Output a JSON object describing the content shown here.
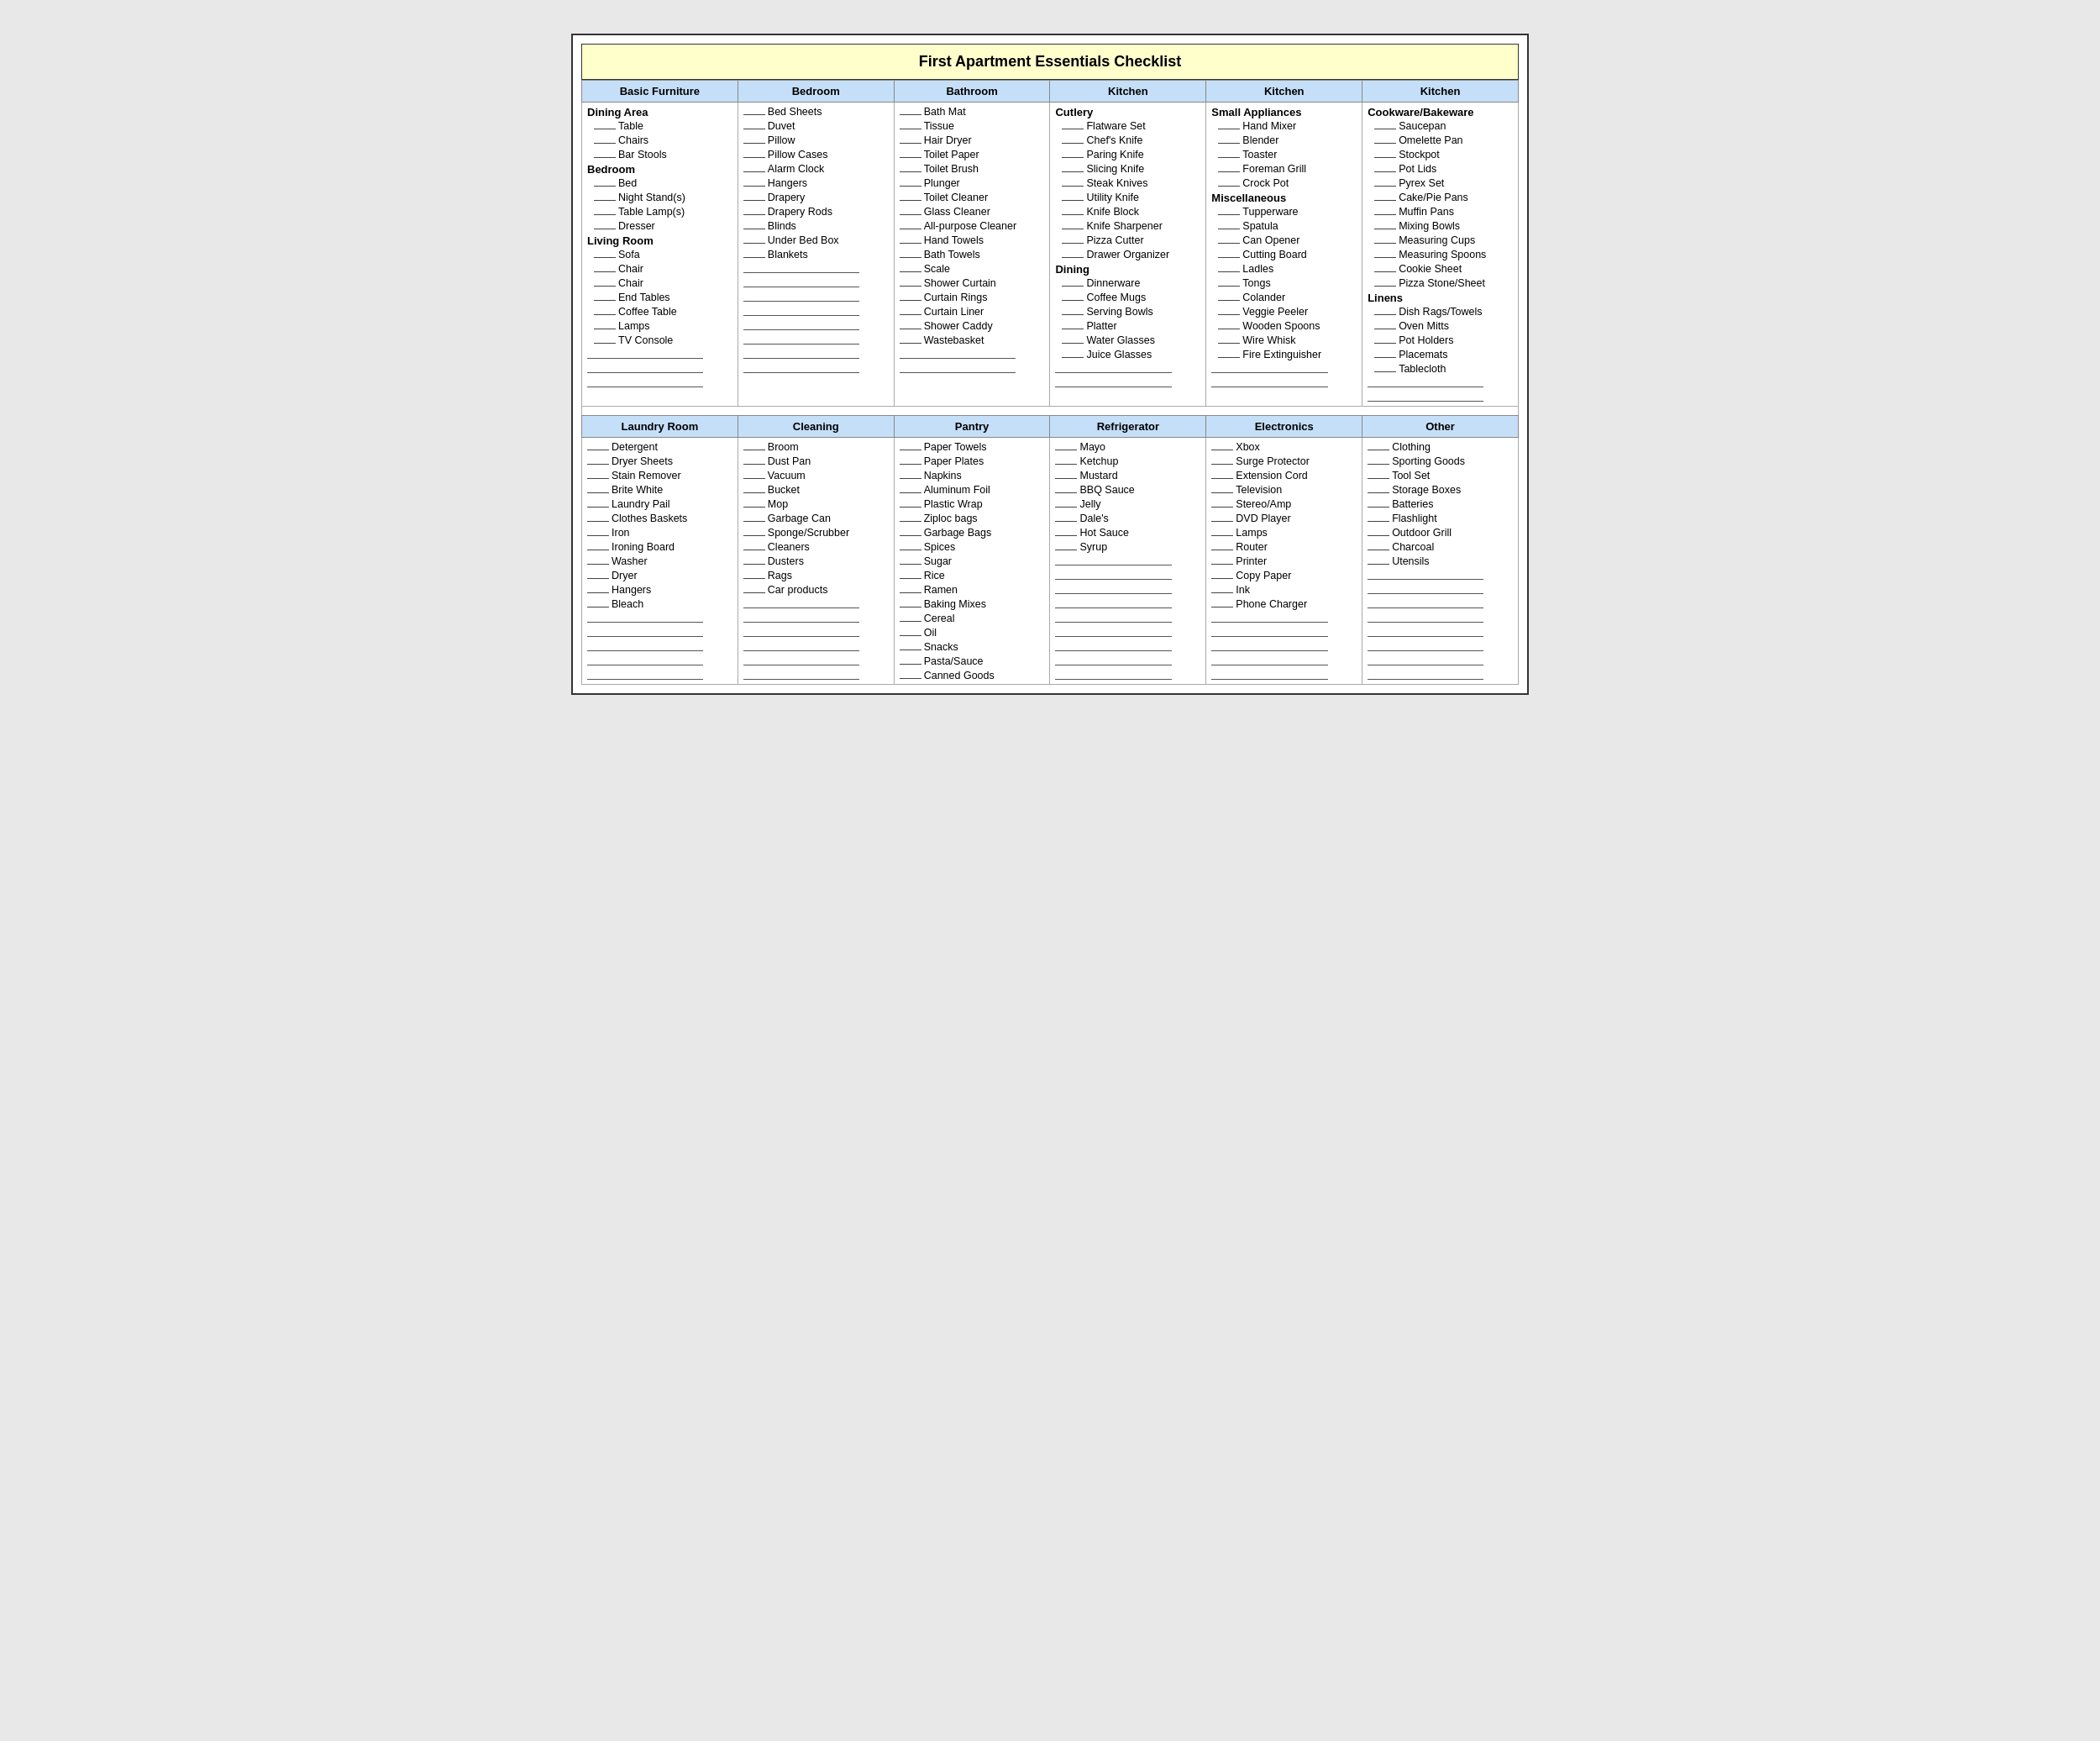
{
  "title": "First Apartment Essentials Checklist",
  "topSection": {
    "headers": [
      "Basic Furniture",
      "Bedroom",
      "Bathroom",
      "Kitchen",
      "Kitchen",
      "Kitchen"
    ],
    "subHeaders": [
      "",
      "",
      "",
      "Cutlery",
      "Small Appliances",
      "Cookware/Bakeware"
    ],
    "col1": {
      "groups": [
        {
          "header": "Dining Area",
          "items": [
            "Table",
            "Chairs",
            "Bar Stools"
          ]
        },
        {
          "header": "Bedroom",
          "items": [
            "Bed",
            "Night Stand(s)",
            "Table Lamp(s)",
            "Dresser"
          ]
        },
        {
          "header": "Living Room",
          "items": [
            "Sofa",
            "Chair",
            "Chair",
            "End Tables",
            "Coffee Table",
            "Lamps",
            "TV Console"
          ]
        }
      ]
    },
    "col2": {
      "items": [
        "Bed Sheets",
        "Duvet",
        "Pillow",
        "Pillow Cases",
        "Alarm Clock",
        "Hangers",
        "Drapery",
        "Drapery Rods",
        "Blinds",
        "Under Bed Box",
        "Blankets"
      ]
    },
    "col3": {
      "subHeader": "",
      "items": [
        "Bath Mat",
        "Tissue",
        "Hair Dryer",
        "Toilet Paper",
        "Toilet Brush",
        "Plunger",
        "Toilet Cleaner",
        "Glass Cleaner",
        "All-purpose Cleaner",
        "Hand Towels",
        "Bath Towels",
        "Scale",
        "Shower Curtain",
        "Curtain Rings",
        "Curtain Liner",
        "Shower Caddy",
        "Wastebasket"
      ]
    },
    "col4": {
      "subHeader": "Cutlery",
      "items": [
        "Flatware Set",
        "Chef's Knife",
        "Paring Knife",
        "Slicing Knife",
        "Steak Knives",
        "Utility Knife",
        "Knife Block",
        "Knife Sharpener",
        "Pizza Cutter",
        "Drawer Organizer"
      ],
      "subHeader2": "Dining",
      "items2": [
        "Dinnerware",
        "Coffee Mugs",
        "Serving Bowls",
        "Platter",
        "Water Glasses",
        "Juice Glasses"
      ]
    },
    "col5": {
      "subHeader": "Small Appliances",
      "items": [
        "Hand Mixer",
        "Blender",
        "Toaster",
        "Foreman Grill",
        "Crock Pot"
      ],
      "subHeader2": "Miscellaneous",
      "items2": [
        "Tupperware",
        "Spatula",
        "Can Opener",
        "Cutting Board",
        "Ladles",
        "Tongs",
        "Colander",
        "Veggie Peeler",
        "Wooden Spoons",
        "Wire Whisk",
        "Fire Extinguisher"
      ]
    },
    "col6": {
      "subHeader": "Cookware/Bakeware",
      "items": [
        "Saucepan",
        "Omelette Pan",
        "Stockpot",
        "Pot Lids",
        "Pyrex Set",
        "Cake/Pie Pans",
        "Muffin Pans",
        "Mixing Bowls",
        "Measuring Cups",
        "Measuring Spoons",
        "Cookie Sheet",
        "Pizza Stone/Sheet"
      ],
      "subHeader2": "Linens",
      "items2": [
        "Dish Rags/Towels",
        "Oven Mitts",
        "Pot Holders",
        "Placemats",
        "Tablecloth"
      ]
    }
  },
  "bottomSection": {
    "headers": [
      "Laundry Room",
      "Cleaning",
      "Pantry",
      "Refrigerator",
      "Electronics",
      "Other"
    ],
    "col1": {
      "items": [
        "Detergent",
        "Dryer Sheets",
        "Stain Remover",
        "Brite White",
        "Laundry Pail",
        "Clothes Baskets",
        "Iron",
        "Ironing Board",
        "Washer",
        "Dryer",
        "Hangers",
        "Bleach"
      ]
    },
    "col2": {
      "items": [
        "Broom",
        "Dust Pan",
        "Vacuum",
        "Bucket",
        "Mop",
        "Garbage Can",
        "Sponge/Scrubber",
        "Cleaners",
        "Dusters",
        "Rags",
        "Car products"
      ]
    },
    "col3": {
      "items": [
        "Paper Towels",
        "Paper Plates",
        "Napkins",
        "Aluminum Foil",
        "Plastic Wrap",
        "Ziploc bags",
        "Garbage Bags",
        "Spices",
        "Sugar",
        "Rice",
        "Ramen",
        "Baking Mixes",
        "Cereal",
        "Oil",
        "Snacks",
        "Pasta/Sauce",
        "Canned Goods"
      ]
    },
    "col4": {
      "items": [
        "Mayo",
        "Ketchup",
        "Mustard",
        "BBQ Sauce",
        "Jelly",
        "Dale's",
        "Hot Sauce",
        "Syrup"
      ]
    },
    "col5": {
      "items": [
        "Xbox",
        "Surge Protector",
        "Extension Cord",
        "Television",
        "Stereo/Amp",
        "DVD Player",
        "Lamps",
        "Router",
        "Printer",
        "Copy Paper",
        "Ink",
        "Phone Charger"
      ]
    },
    "col6": {
      "items": [
        "Clothing",
        "Sporting Goods",
        "Tool Set",
        "Storage Boxes",
        "Batteries",
        "Flashlight",
        "Outdoor Grill",
        "Charcoal",
        "Utensils"
      ]
    }
  }
}
